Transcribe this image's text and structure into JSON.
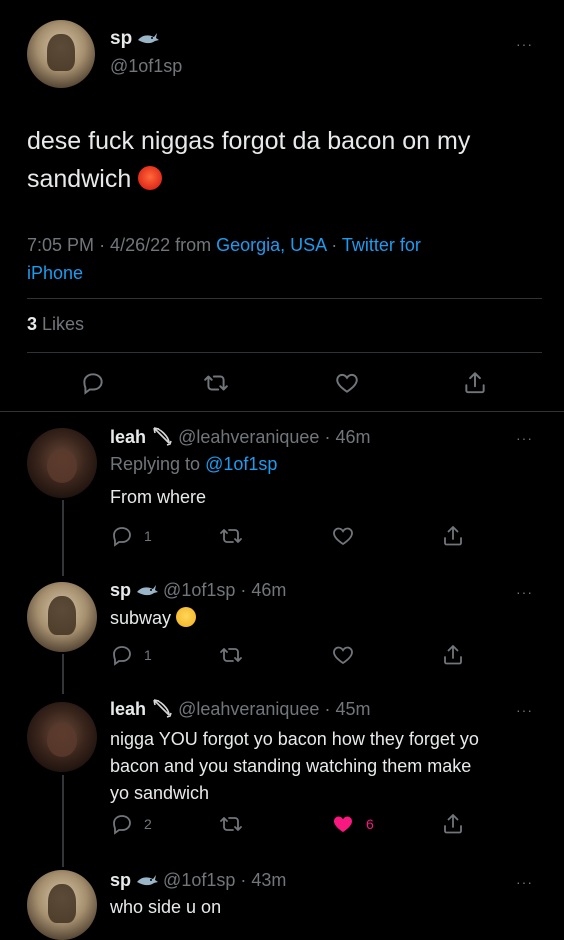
{
  "main_tweet": {
    "display_name": "sp",
    "handle": "@1of1sp",
    "text": "dese fuck niggas forgot da bacon on my sandwich",
    "time": "7:05 PM",
    "date": "· 4/26/22 from",
    "location": "Georgia, USA",
    "sep": "·",
    "source_line1": "Twitter for",
    "source_line2": "iPhone",
    "likes_count": "3",
    "likes_label": "Likes"
  },
  "replies": [
    {
      "display_name": "leah",
      "handle": "@leahveraniquee",
      "age": "· 46m",
      "replying_label": "Replying to",
      "replying_to": "@1of1sp",
      "text": "From where",
      "reply_count": "1"
    },
    {
      "display_name": "sp",
      "handle": "@1of1sp",
      "age": "· 46m",
      "text": "subway",
      "reply_count": "1"
    },
    {
      "display_name": "leah",
      "handle": "@leahveraniquee",
      "age": "· 45m",
      "text_lines": [
        "nigga YOU forgot yo bacon how they forget yo",
        "bacon and you standing watching them make",
        "yo sandwich"
      ],
      "reply_count": "2",
      "like_count": "6"
    },
    {
      "display_name": "sp",
      "handle": "@1of1sp",
      "age": "· 43m",
      "text": "who side u on"
    }
  ],
  "more_label": "···",
  "colors": {
    "background": "#000000",
    "link": "#1d9bf0",
    "muted": "#71767b",
    "like_active": "#f91880"
  }
}
